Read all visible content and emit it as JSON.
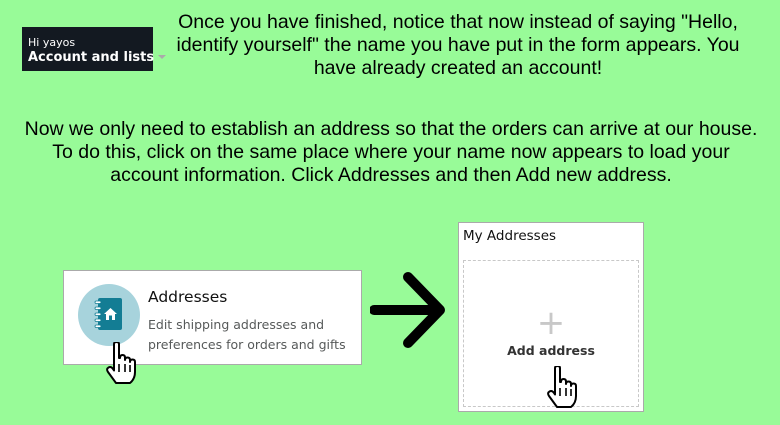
{
  "account_nav": {
    "greeting": "Hi yayos",
    "label": "Account and lists"
  },
  "instructions": {
    "paragraph1": "Once you have finished, notice that now instead of saying \"Hello, identify yourself\" the name you have put in the form appears. You have already created an account!",
    "paragraph2": "Now we only need to establish an address so that the orders can arrive at our house. To do this, click on the same place where your name now appears to load your account information. Click Addresses and then Add new address."
  },
  "addresses_card": {
    "title": "Addresses",
    "description": "Edit shipping addresses and preferences for orders and gifts",
    "icon": "address-book-icon"
  },
  "my_addresses_panel": {
    "title": "My Addresses",
    "add_label": "Add address",
    "plus_glyph": "+"
  },
  "colors": {
    "background": "#98fb98",
    "nav_background": "#131921",
    "icon_teal": "#137d94",
    "icon_circle": "#a7d3dc"
  }
}
